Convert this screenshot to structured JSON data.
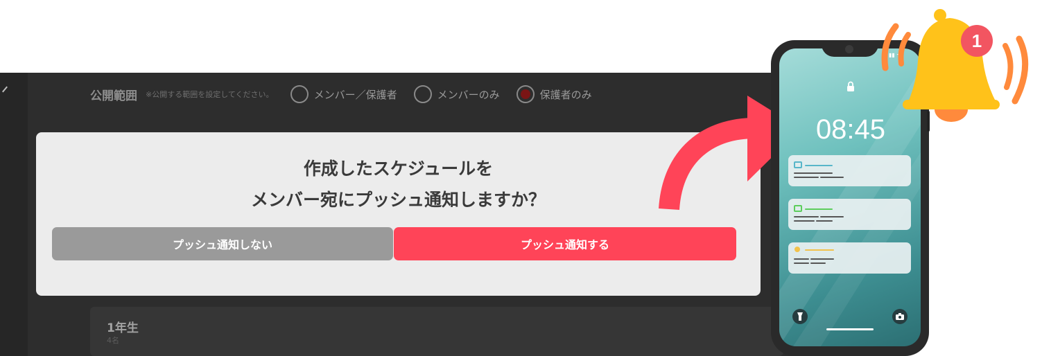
{
  "background_form": {
    "visibility_label": "公開範囲",
    "visibility_hint": "※公開する範囲を設定してください。",
    "options": [
      {
        "label": "メンバー／保護者",
        "checked": false
      },
      {
        "label": "メンバーのみ",
        "checked": false
      },
      {
        "label": "保護者のみ",
        "checked": true
      }
    ],
    "group_card": {
      "title": "1年生",
      "count": "4名"
    }
  },
  "modal": {
    "title_line1": "作成したスケジュールを",
    "title_line2": "メンバー宛にプッシュ通知しますか？",
    "cancel_label": "プッシュ通知しない",
    "confirm_label": "プッシュ通知する"
  },
  "phone": {
    "time": "08:45",
    "notification_colors": [
      "#57b6c9",
      "#5ccd5c",
      "#f2c24a"
    ]
  },
  "bell": {
    "badge_count": "1"
  },
  "colors": {
    "accent": "#ff4458",
    "cancel_button": "#9a9a9a",
    "bell": "#ffc21a",
    "badge": "#f25561"
  }
}
